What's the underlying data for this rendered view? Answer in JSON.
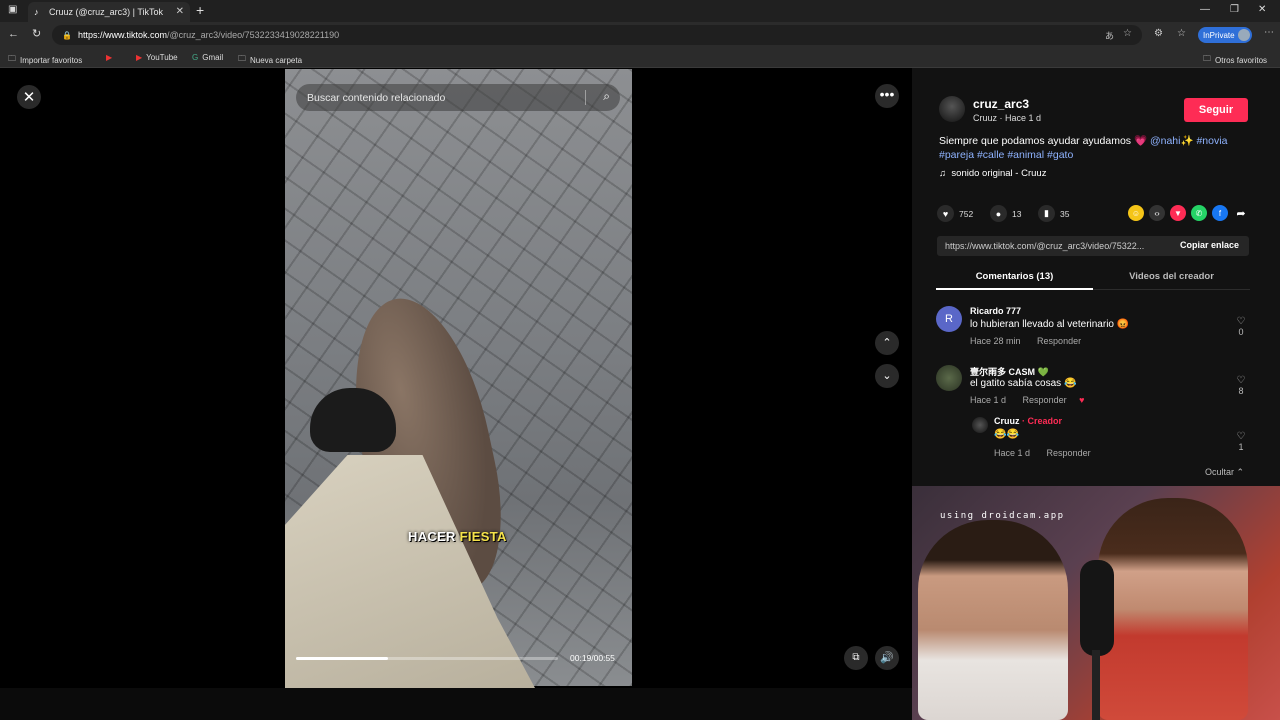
{
  "browser": {
    "tab_title": "Cruuz (@cruz_arc3) | TikTok",
    "url_host": "https://www.tiktok.com",
    "url_path": "/@cruz_arc3/video/7532233419028221190",
    "inprivate": "InPrivate",
    "bookmarks": [
      "Importar favoritos",
      "YouTube",
      "Gmail",
      "Nueva carpeta"
    ],
    "other_bookmarks": "Otros favoritos"
  },
  "video": {
    "search_placeholder": "Buscar contenido relacionado",
    "caption_word1": "HACER",
    "caption_word2": "FIESTA",
    "timecode": "00:19/00:55",
    "progress": 0.35
  },
  "post": {
    "username": "cruz_arc3",
    "subline": "Cruuz · Hace 1 d",
    "follow": "Seguir",
    "desc_text": "Siempre que podamos ayudar ayudamos 💗 ",
    "mention": "@nahi✨",
    "tags": [
      "#novia",
      "#pareja",
      "#calle",
      "#animal",
      "#gato"
    ],
    "sound": "sonido original - Cruuz",
    "likes": "752",
    "comments_count": "13",
    "saves": "35",
    "link": "https://www.tiktok.com/@cruz_arc3/video/75322...",
    "copy_link": "Copiar enlace"
  },
  "tabs": {
    "comments": "Comentarios (13)",
    "videos": "Videos del creador"
  },
  "comments": [
    {
      "initial": "R",
      "name": "Ricardo 777",
      "text": "lo hubieran llevado al veterinario 😡",
      "time": "Hace 28 min",
      "reply": "Responder",
      "likes": "0"
    },
    {
      "initial": "",
      "name": "壹尔雨多 CASM 💚",
      "text": "el gatito sabía cosas 😂",
      "time": "Hace 1 d",
      "reply": "Responder",
      "likes": "8"
    },
    {
      "initial": "",
      "name": "Cruuz",
      "creator": "· Creador",
      "text": "😂😂",
      "time": "Hace 1 d",
      "reply": "Responder",
      "likes": "1"
    }
  ],
  "hide_replies": "Ocultar ⌃",
  "webcam_text": "using droidcam.app"
}
